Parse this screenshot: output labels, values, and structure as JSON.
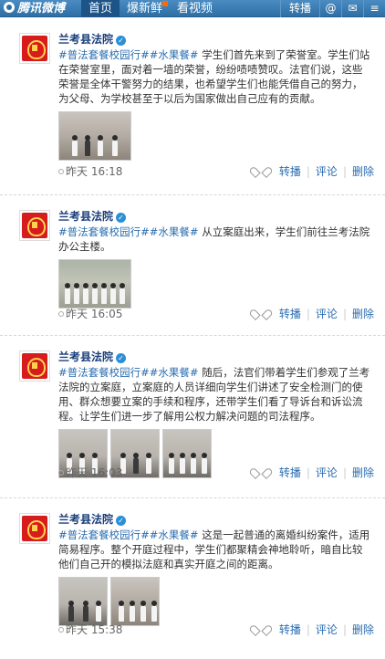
{
  "topbar": {
    "logo": "腾讯微博",
    "nav": [
      {
        "label": "首页",
        "active": true
      },
      {
        "label": "爆新鲜",
        "active": false
      },
      {
        "label": "看视频",
        "active": false
      }
    ],
    "repost_label": "转播",
    "right_icons": [
      "at-icon",
      "mail-icon",
      "menu-icon"
    ]
  },
  "posts": [
    {
      "author": "兰考县法院",
      "hashtags": "#普法套餐校园行##水果餐#",
      "text": " 学生们首先来到了荣誉室。学生们站在荣誉室里，面对着一墙的荣誉，纷纷啧啧赞叹。法官们说，这些荣誉是全体干警努力的结果，也希望学生们也能凭借自己的努力，为父母、为学校甚至于以后为国家做出自己应有的贡献。",
      "time": "昨天 16:18",
      "thumbnails": 1,
      "actions": {
        "repost": "转播",
        "comment": "评论",
        "delete": "删除"
      }
    },
    {
      "author": "兰考县法院",
      "hashtags": "#普法套餐校园行##水果餐#",
      "text": " 从立案庭出来，学生们前往兰考法院办公主楼。",
      "time": "昨天 16:05",
      "thumbnails": 1,
      "actions": {
        "repost": "转播",
        "comment": "评论",
        "delete": "删除"
      }
    },
    {
      "author": "兰考县法院",
      "hashtags": "#普法套餐校园行##水果餐#",
      "text": " 随后，法官们带着学生们参观了兰考法院的立案庭，立案庭的人员详细向学生们讲述了安全检测门的使用、群众想要立案的手续和程序，还带学生们看了导诉台和诉讼流程。让学生们进一步了解用公权力解决问题的司法程序。",
      "time": "昨天 16:03",
      "thumbnails": 3,
      "actions": {
        "repost": "转播",
        "comment": "评论",
        "delete": "删除"
      }
    },
    {
      "author": "兰考县法院",
      "hashtags": "#普法套餐校园行##水果餐#",
      "text": " 这是一起普通的离婚纠纷案件，适用简易程序。整个开庭过程中，学生们都聚精会神地聆听，暗自比较他们自己开的模拟法庭和真实开庭之间的距离。",
      "time": "昨天 15:38",
      "thumbnails": 2,
      "actions": {
        "repost": "转播",
        "comment": "评论",
        "delete": "删除"
      }
    }
  ]
}
